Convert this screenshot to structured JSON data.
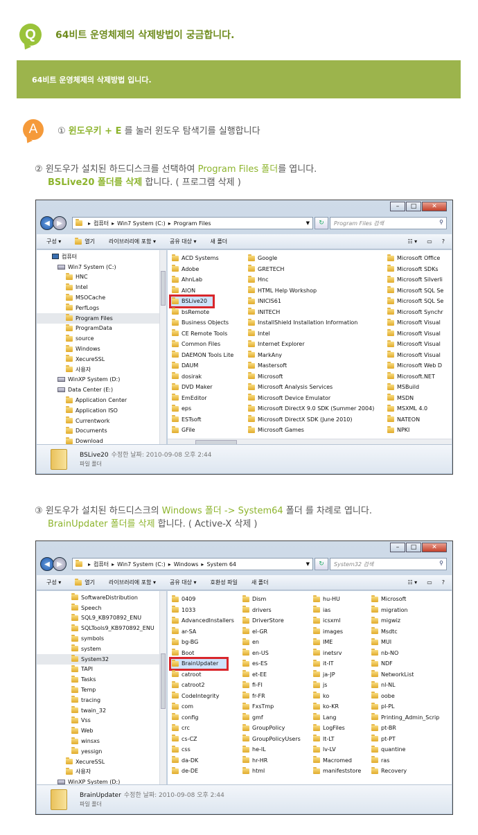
{
  "question": {
    "icon": "Q",
    "title": "64비트 운영체제의 삭제방법이 궁금합니다."
  },
  "banner": {
    "text": "64비트 운영체제의 삭제방법 입니다."
  },
  "answer": {
    "icon": "A",
    "step1": {
      "num": "①",
      "hl": "윈도우키 + E",
      "rest": " 를 눌러 윈도우 탐색기를 실행합니다"
    },
    "step2": {
      "line1_pre": "② 윈도우가 설치된 하드디스크를 선택하여 ",
      "line1_hl": "Program Files 폴더",
      "line1_post": "를 엽니다.",
      "line2_hl": "BSLive20 폴더를 삭제",
      "line2_post": " 합니다. ( 프로그램 삭제 )"
    },
    "step3": {
      "line1_pre": "③ 윈도우가 설치된 하드디스크의 ",
      "line1_hl1": "Windows 폴더",
      "line1_mid": "  -> ",
      "line1_hl2": " System64",
      "line1_post": " 폴더 를 차례로 엽니다.",
      "line2_hl": "BrainUpdater 폴더를 삭제",
      "line2_post": " 합니다. ( Active-X 삭제 )"
    }
  },
  "window1": {
    "address": [
      "컴퓨터",
      "Win7 System (C:)",
      "Program Files"
    ],
    "search_placeholder": "Program Files 검색",
    "toolbar": [
      "구성 ▾",
      "열기",
      "라이브러리에 포함 ▾",
      "공유 대상 ▾",
      "새 폴더"
    ],
    "tree": [
      {
        "label": "컴퓨터",
        "icon": "pc"
      },
      {
        "label": "Win7 System (C:)",
        "icon": "drive"
      },
      {
        "label": "HNC"
      },
      {
        "label": "Intel"
      },
      {
        "label": "MSOCache"
      },
      {
        "label": "PerfLogs"
      },
      {
        "label": "Program Files",
        "selected": true
      },
      {
        "label": "ProgramData"
      },
      {
        "label": "source"
      },
      {
        "label": "Windows"
      },
      {
        "label": "XecureSSL"
      },
      {
        "label": "사용자"
      },
      {
        "label": "WinXP System (D:)",
        "icon": "drive"
      },
      {
        "label": "Data Center (E:)",
        "icon": "drive"
      },
      {
        "label": "Application Center"
      },
      {
        "label": "Application ISO"
      },
      {
        "label": "Currentwork"
      },
      {
        "label": "Documents"
      },
      {
        "label": "Download"
      }
    ],
    "columns": [
      [
        "ACD Systems",
        "Adobe",
        "AhnLab",
        "AION",
        "BSLive20",
        "bsRemote",
        "Business Objects",
        "CE Remote Tools",
        "Common Files",
        "DAEMON Tools Lite",
        "DAUM",
        "dosirak",
        "DVD Maker",
        "EmEditor",
        "eps",
        "ESTsoft",
        "GFile"
      ],
      [
        "Google",
        "GRETECH",
        "Hnc",
        "HTML Help Workshop",
        "INICIS61",
        "INITECH",
        "InstallShield Installation Information",
        "Intel",
        "Internet Explorer",
        "MarkAny",
        "Mastersoft",
        "Microsoft",
        "Microsoft Analysis Services",
        "Microsoft Device Emulator",
        "Microsoft DirectX 9.0 SDK (Summer 2004)",
        "Microsoft DirectX SDK (June 2010)",
        "Microsoft Games"
      ],
      [
        "Microsoft Office",
        "Microsoft SDKs",
        "Microsoft Silverli",
        "Microsoft SQL Se",
        "Microsoft SQL Se",
        "Microsoft Synchr",
        "Microsoft Visual",
        "Microsoft Visual",
        "Microsoft Visual",
        "Microsoft Visual",
        "Microsoft Web D",
        "Microsoft.NET",
        "MSBuild",
        "MSDN",
        "MSXML 4.0",
        "NATEON",
        "NPKI"
      ]
    ],
    "highlight": "BSLive20",
    "status": {
      "name": "BSLive20",
      "meta": "수정한 날짜: 2010-09-08 오후 2:44",
      "type": "파일 폴더"
    }
  },
  "window2": {
    "address": [
      "컴퓨터",
      "Win7 System (C:)",
      "Windows",
      "System 64"
    ],
    "search_placeholder": "System32 검색",
    "toolbar": [
      "구성 ▾",
      "열기",
      "라이브러리에 포함 ▾",
      "공유 대상 ▾",
      "호환성 파일",
      "새 폴더"
    ],
    "tree": [
      {
        "label": "SoftwareDistribution"
      },
      {
        "label": "Speech"
      },
      {
        "label": "SQL9_KB970892_ENU"
      },
      {
        "label": "SQLTools9_KB970892_ENU"
      },
      {
        "label": "symbols"
      },
      {
        "label": "system"
      },
      {
        "label": "System32",
        "selected": true
      },
      {
        "label": "TAPI"
      },
      {
        "label": "Tasks"
      },
      {
        "label": "Temp"
      },
      {
        "label": "tracing"
      },
      {
        "label": "twain_32"
      },
      {
        "label": "Vss"
      },
      {
        "label": "Web"
      },
      {
        "label": "winsxs"
      },
      {
        "label": "yessign"
      },
      {
        "label": "XecureSSL",
        "indent": 1
      },
      {
        "label": "사용자",
        "indent": 1
      },
      {
        "label": "WinXP System (D:)",
        "icon": "drive",
        "indent": 2
      }
    ],
    "columns": [
      [
        "0409",
        "1033",
        "AdvancedInstallers",
        "ar-SA",
        "bg-BG",
        "Boot",
        "BrainUpdater",
        "catroot",
        "catroot2",
        "CodeIntegrity",
        "com",
        "config",
        "crc",
        "cs-CZ",
        "css",
        "da-DK",
        "de-DE"
      ],
      [
        "Dism",
        "drivers",
        "DriverStore",
        "el-GR",
        "en",
        "en-US",
        "es-ES",
        "et-EE",
        "fi-FI",
        "fr-FR",
        "FxsTmp",
        "gmf",
        "GroupPolicy",
        "GroupPolicyUsers",
        "he-IL",
        "hr-HR",
        "html"
      ],
      [
        "hu-HU",
        "ias",
        "icsxml",
        "images",
        "IME",
        "inetsrv",
        "it-IT",
        "ja-JP",
        "js",
        "ko",
        "ko-KR",
        "Lang",
        "LogFiles",
        "lt-LT",
        "lv-LV",
        "Macromed",
        "manifeststore"
      ],
      [
        "Microsoft",
        "migration",
        "migwiz",
        "Msdtc",
        "MUI",
        "nb-NO",
        "NDF",
        "NetworkList",
        "nl-NL",
        "oobe",
        "pl-PL",
        "Printing_Admin_Scrip",
        "pt-BR",
        "pt-PT",
        "quantine",
        "ras",
        "Recovery"
      ]
    ],
    "highlight": "BrainUpdater",
    "status": {
      "name": "BrainUpdater",
      "meta": "수정한 날짜: 2010-09-08 오후 2:44",
      "type": "파일 폴더"
    }
  }
}
